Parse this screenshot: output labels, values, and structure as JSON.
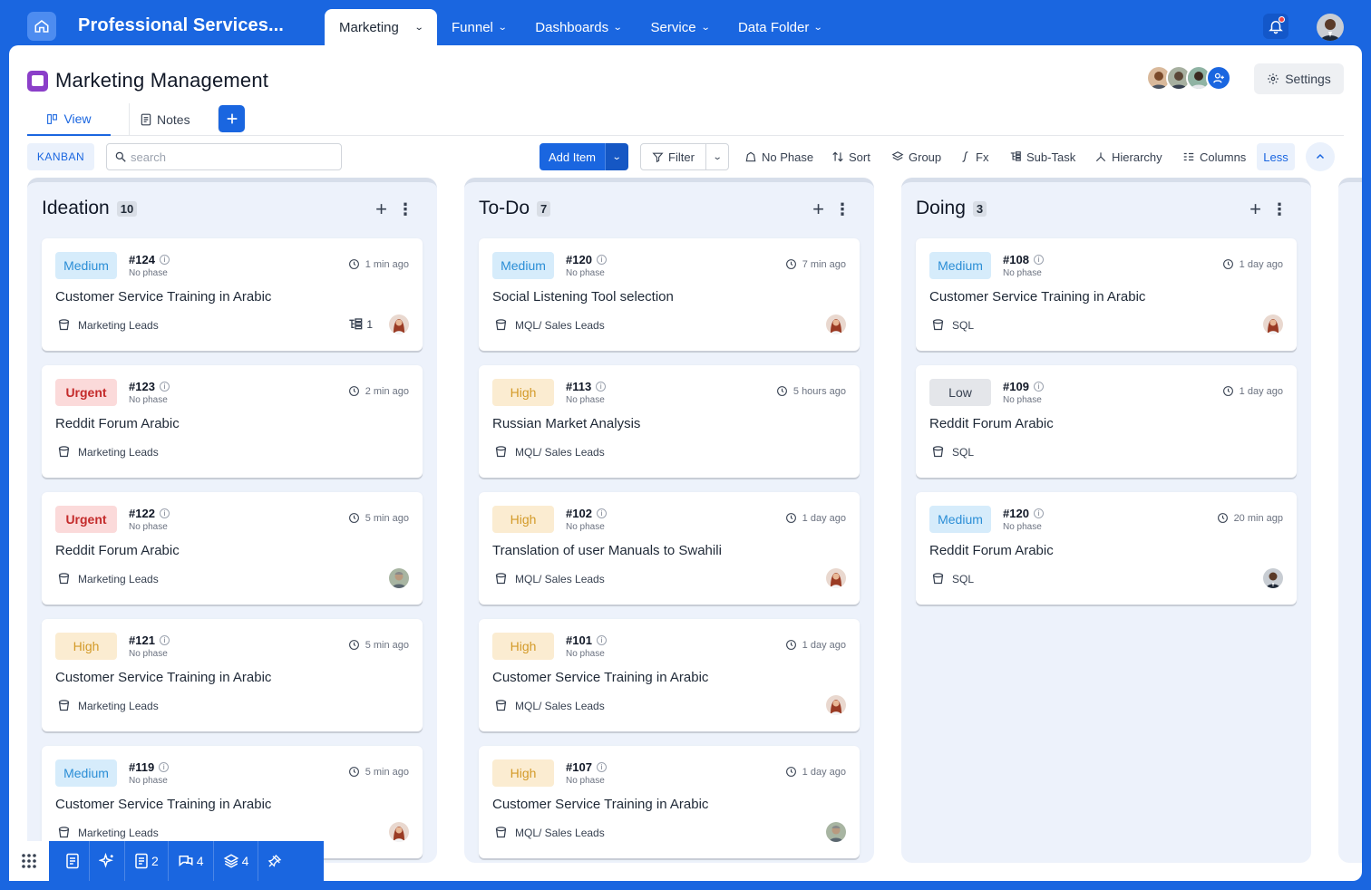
{
  "app": {
    "title": "Professional Services..."
  },
  "nav": [
    {
      "label": "Marketing",
      "active": true
    },
    {
      "label": "Funnel"
    },
    {
      "label": "Dashboards"
    },
    {
      "label": "Service"
    },
    {
      "label": "Data Folder"
    }
  ],
  "page": {
    "title": "Marketing Management",
    "settings_label": "Settings"
  },
  "tabs": {
    "view": "View",
    "notes": "Notes"
  },
  "toolbar": {
    "kanban": "KANBAN",
    "search_placeholder": "search",
    "add_item": "Add Item",
    "filter": "Filter",
    "no_phase": "No Phase",
    "sort": "Sort",
    "group": "Group",
    "fx": "Fx",
    "sub_task": "Sub-Task",
    "hierarchy": "Hierarchy",
    "columns": "Columns",
    "less": "Less"
  },
  "columns": [
    {
      "name": "Ideation",
      "count": "10",
      "cards": [
        {
          "priority": "Medium",
          "id": "#124",
          "phase": "No phase",
          "time": "1 min ago",
          "title": "Customer Service Training in Arabic",
          "folder": "Marketing Leads",
          "subtasks": "1",
          "avatar": "woman-red-hair"
        },
        {
          "priority": "Urgent",
          "id": "#123",
          "phase": "No phase",
          "time": "2 min ago",
          "title": "Reddit Forum Arabic",
          "folder": "Marketing Leads"
        },
        {
          "priority": "Urgent",
          "id": "#122",
          "phase": "No phase",
          "time": "5 min ago",
          "title": "Reddit Forum Arabic",
          "folder": "Marketing Leads",
          "avatar": "man-grey"
        },
        {
          "priority": "High",
          "id": "#121",
          "phase": "No phase",
          "time": "5 min ago",
          "title": "Customer Service Training in Arabic",
          "folder": "Marketing Leads"
        },
        {
          "priority": "Medium",
          "id": "#119",
          "phase": "No phase",
          "time": "5 min ago",
          "title": "Customer Service Training in Arabic",
          "folder": "Marketing Leads",
          "avatar": "woman-red-hair"
        }
      ]
    },
    {
      "name": "To-Do",
      "count": "7",
      "cards": [
        {
          "priority": "Medium",
          "id": "#120",
          "phase": "No phase",
          "time": "7 min ago",
          "title": "Social Listening Tool selection",
          "folder": "MQL/ Sales Leads",
          "avatar": "woman-red-hair"
        },
        {
          "priority": "High",
          "id": "#113",
          "phase": "No phase",
          "time": "5 hours ago",
          "title": "Russian Market Analysis",
          "folder": "MQL/ Sales Leads"
        },
        {
          "priority": "High",
          "id": "#102",
          "phase": "No phase",
          "time": "1 day ago",
          "title": "Translation of user Manuals to Swahili",
          "folder": "MQL/ Sales Leads",
          "avatar": "woman-red-hair"
        },
        {
          "priority": "High",
          "id": "#101",
          "phase": "No phase",
          "time": "1 day ago",
          "title": "Customer Service Training in Arabic",
          "folder": "MQL/ Sales Leads",
          "avatar": "woman-red-hair"
        },
        {
          "priority": "High",
          "id": "#107",
          "phase": "No phase",
          "time": "1 day ago",
          "title": "Customer Service Training in Arabic",
          "folder": "MQL/ Sales Leads",
          "avatar": "man-grey"
        }
      ]
    },
    {
      "name": "Doing",
      "count": "3",
      "cards": [
        {
          "priority": "Medium",
          "id": "#108",
          "phase": "No phase",
          "time": "1 day ago",
          "title": "Customer Service Training in Arabic",
          "folder": "SQL",
          "avatar": "woman-red-hair"
        },
        {
          "priority": "Low",
          "id": "#109",
          "phase": "No phase",
          "time": "1 day ago",
          "title": "Reddit Forum Arabic",
          "folder": "SQL"
        },
        {
          "priority": "Medium",
          "id": "#120",
          "phase": "No phase",
          "time": "20 min agp",
          "title": "Reddit Forum Arabic",
          "folder": "SQL",
          "avatar": "man-dark"
        }
      ]
    }
  ],
  "dock": {
    "notes_count": "2",
    "chat_count": "4",
    "layers_count": "4"
  },
  "colors": {
    "brand": "#1a66e0",
    "medium": "#2b8ed6",
    "urgent": "#c42b2b",
    "high": "#d39a28"
  }
}
